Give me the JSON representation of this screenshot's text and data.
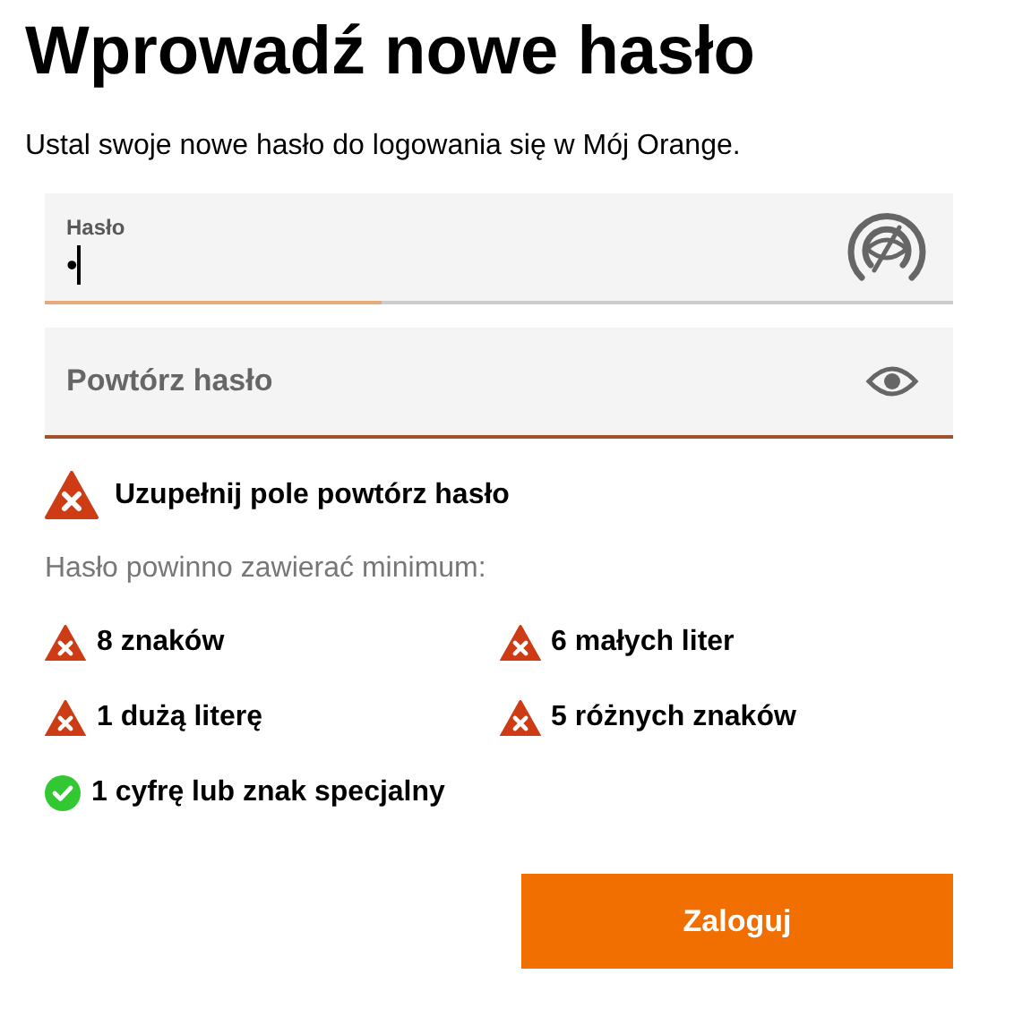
{
  "title": "Wprowadź nowe hasło",
  "subtitle": "Ustal swoje nowe hasło do logowania się w Mój Orange.",
  "password": {
    "label": "Hasło",
    "value": "•",
    "strength": {
      "level": 0.37
    }
  },
  "repeat": {
    "placeholder": "Powtórz hasło",
    "error": true
  },
  "error": "Uzupełnij pole powtórz hasło",
  "hint": "Hasło powinno zawierać minimum:",
  "requirements": [
    {
      "label": "8 znaków",
      "met": false
    },
    {
      "label": "6 małych liter",
      "met": false
    },
    {
      "label": "1 dużą literę",
      "met": false
    },
    {
      "label": "5 różnych znaków",
      "met": false
    },
    {
      "label": "1 cyfrę lub znak specjalny",
      "met": true
    }
  ],
  "button": "Zaloguj"
}
